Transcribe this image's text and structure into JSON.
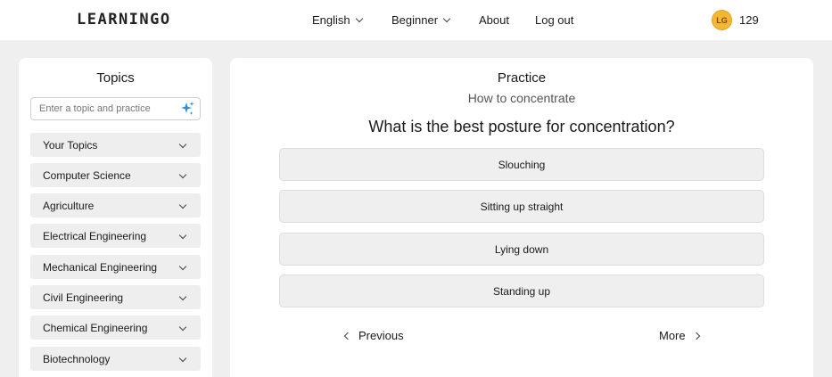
{
  "header": {
    "logo": "LEARNINGO",
    "nav": [
      {
        "label": "English"
      },
      {
        "label": "Beginner"
      },
      {
        "label": "About"
      },
      {
        "label": "Log out"
      }
    ],
    "avatar_initials": "LG",
    "points": "129"
  },
  "sidebar": {
    "title": "Topics",
    "search_placeholder": "Enter a topic and practice",
    "topics": [
      {
        "label": "Your Topics"
      },
      {
        "label": "Computer Science"
      },
      {
        "label": "Agriculture"
      },
      {
        "label": "Electrical Engineering"
      },
      {
        "label": "Mechanical Engineering"
      },
      {
        "label": "Civil Engineering"
      },
      {
        "label": "Chemical Engineering"
      },
      {
        "label": "Biotechnology"
      }
    ]
  },
  "main": {
    "heading": "Practice",
    "subtitle": "How to concentrate",
    "question": "What is the best posture for concentration?",
    "options": [
      {
        "label": "Slouching"
      },
      {
        "label": "Sitting up straight"
      },
      {
        "label": "Lying down"
      },
      {
        "label": "Standing up"
      }
    ],
    "previous_label": "Previous",
    "more_label": "More"
  },
  "colors": {
    "background": "#efefef",
    "panel": "#ffffff",
    "avatar": "#f4b733",
    "sparkle": "#2f8fd8"
  }
}
